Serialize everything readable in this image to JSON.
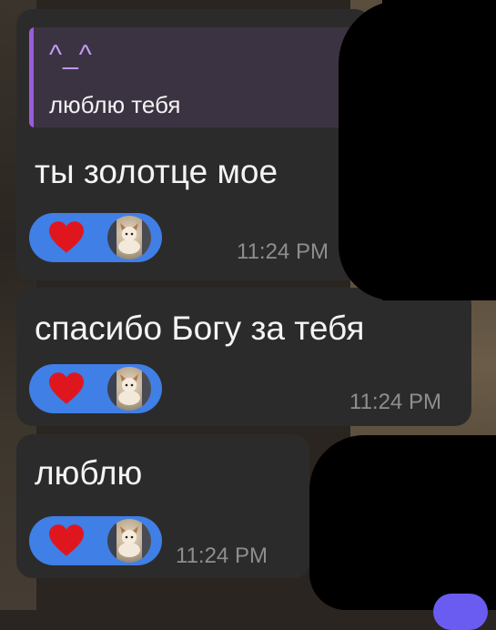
{
  "messages": [
    {
      "reply": {
        "title": "^_^",
        "text": "люблю тебя"
      },
      "text": "ты золотце мое",
      "time": "11:24 PM"
    },
    {
      "text": "спасибо Богу за тебя",
      "time": "11:24 PM"
    },
    {
      "text": "люблю",
      "time": "11:24 PM"
    }
  ],
  "reaction": {
    "icon": "heart-icon",
    "color": "#3f7fe6",
    "heart_color": "#e0161e"
  },
  "colors": {
    "bubble": "#2c2b2b",
    "reply_accent": "#9a5cdc",
    "text": "#f4f4f4",
    "time": "#8e8e8e"
  }
}
